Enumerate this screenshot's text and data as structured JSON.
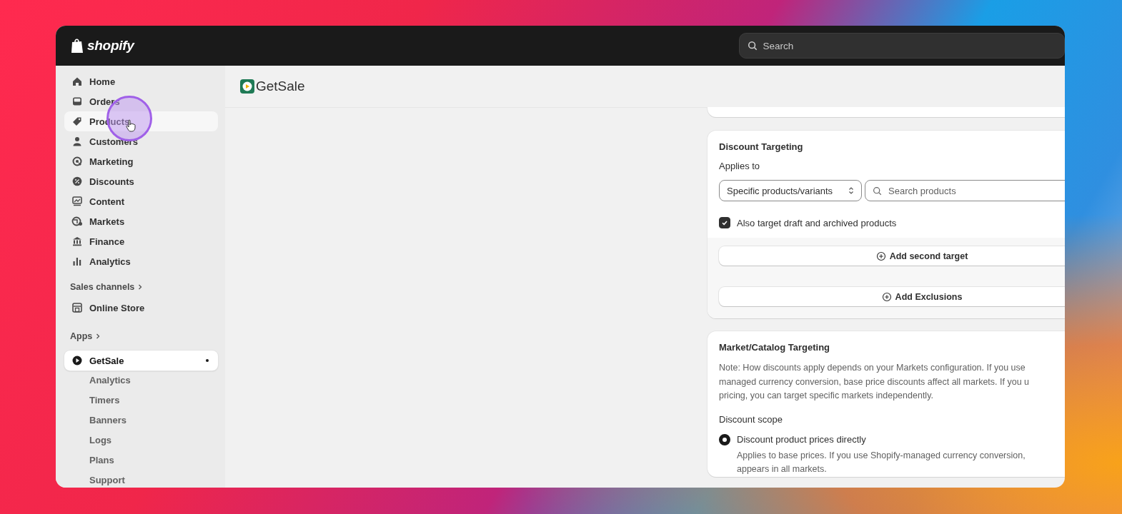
{
  "topbar": {
    "brand": "shopify",
    "search": {
      "placeholder": "Search"
    }
  },
  "sidebar": {
    "items": [
      {
        "label": "Home",
        "selected": false,
        "hovered": false
      },
      {
        "label": "Orders",
        "selected": false,
        "hovered": false
      },
      {
        "label": "Products",
        "selected": false,
        "hovered": true
      },
      {
        "label": "Customers",
        "selected": false,
        "hovered": false
      },
      {
        "label": "Marketing",
        "selected": false,
        "hovered": false
      },
      {
        "label": "Discounts",
        "selected": false,
        "hovered": false
      },
      {
        "label": "Content",
        "selected": false,
        "hovered": false
      },
      {
        "label": "Markets",
        "selected": false,
        "hovered": false
      },
      {
        "label": "Finance",
        "selected": false,
        "hovered": false
      },
      {
        "label": "Analytics",
        "selected": false,
        "hovered": false
      }
    ],
    "sales_channels": {
      "heading": "Sales channels",
      "items": [
        {
          "label": "Online Store",
          "selected": false
        }
      ]
    },
    "apps": {
      "heading": "Apps",
      "items": [
        {
          "label": "GetSale",
          "selected": true,
          "pinned": true,
          "children": [
            {
              "label": "Analytics"
            },
            {
              "label": "Timers"
            },
            {
              "label": "Banners"
            },
            {
              "label": "Logs"
            },
            {
              "label": "Plans"
            },
            {
              "label": "Support"
            }
          ]
        }
      ]
    }
  },
  "page": {
    "app_name": "GetSale"
  },
  "discount_targeting": {
    "title": "Discount Targeting",
    "applies_to_label": "Applies to",
    "select_value": "Specific products/variants",
    "search": {
      "placeholder": "Search products"
    },
    "checkbox": {
      "label": "Also target draft and archived products",
      "checked": true
    },
    "buttons": [
      "Add second target",
      "Add Exclusions"
    ]
  },
  "market_targeting": {
    "title": "Market/Catalog Targeting",
    "note_lines": [
      "Note: How discounts apply depends on your Markets configuration. If you use",
      "managed currency conversion, base price discounts affect all markets. If you u",
      "pricing, you can target specific markets independently."
    ],
    "scope_label": "Discount scope",
    "options": [
      {
        "label": "Discount product prices directly",
        "selected": true,
        "description_lines": [
          "Applies to base prices. If you use Shopify-managed currency conversion,",
          "appears in all markets."
        ]
      }
    ]
  }
}
